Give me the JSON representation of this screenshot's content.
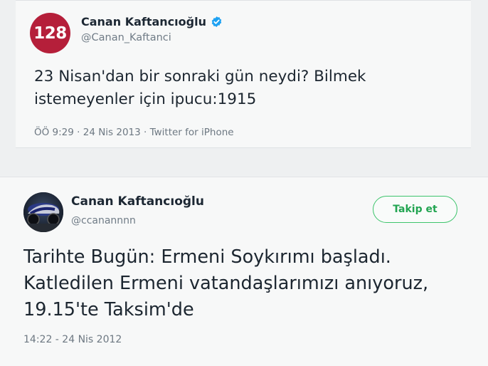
{
  "tweet1": {
    "avatar_text": "128",
    "avatar_color": "#b51f3a",
    "display_name": "Canan Kaftancıoğlu",
    "verified_icon": "verified-badge-icon",
    "handle": "@Canan_Kaftanci",
    "text": "23 Nisan'dan bir sonraki gün neydi? Bilmek istemeyenler için ipucu:1915",
    "meta": "ÖÖ 9:29 · 24 Nis 2013 · Twitter for iPhone"
  },
  "tweet2": {
    "display_name": "Canan Kaftancıoğlu",
    "handle": "@ccanannnn",
    "follow_label": "Takip et",
    "follow_color": "#3ec46c",
    "text": "Tarihte Bugün: Ermeni Soykırımı başladı. Katledilen Ermeni vatandaşlarımızı anıyoruz, 19.15'te Taksim'de",
    "meta": "14:22 - 24 Nis 2012"
  }
}
